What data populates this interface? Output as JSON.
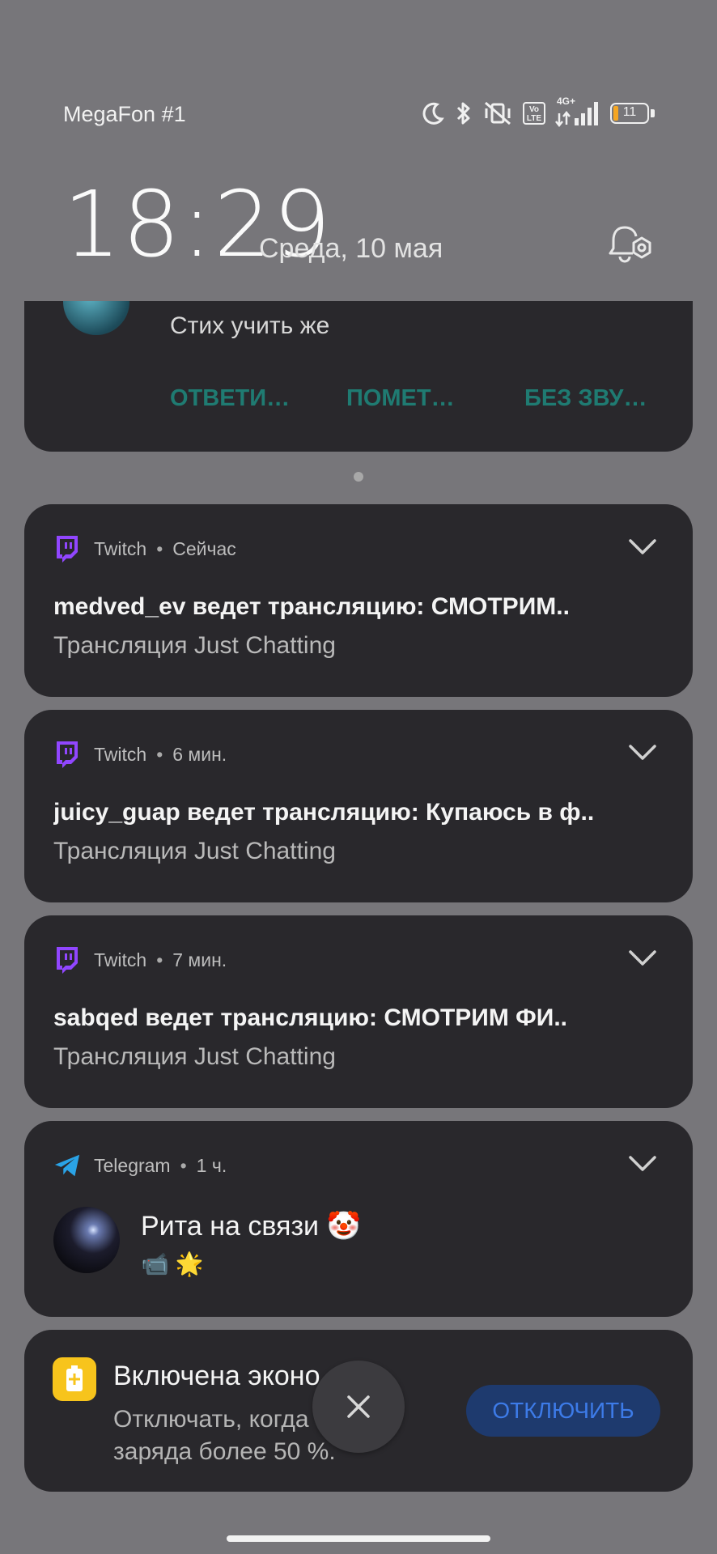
{
  "status_bar": {
    "carrier": "MegaFon #1",
    "network_label": "4G+",
    "volte_label": "Vo LTE",
    "battery_level": "11"
  },
  "lock": {
    "time": "18:29",
    "date": "Среда, 10 мая"
  },
  "top_message": {
    "text": "Стих учить же",
    "actions": [
      "ОТВЕТИ…",
      "ПОМЕТ…",
      "БЕЗ ЗВУ…"
    ]
  },
  "notifications": [
    {
      "app": "Twitch",
      "time": "Сейчас",
      "title": "medved_ev ведет трансляцию: СМОТРИМ..",
      "subtitle": "Трансляция Just Chatting"
    },
    {
      "app": "Twitch",
      "time": "6 мин.",
      "title": "juicy_guap ведет трансляцию: Купаюсь в ф..",
      "subtitle": "Трансляция Just Chatting"
    },
    {
      "app": "Twitch",
      "time": "7 мин.",
      "title": "sabqed ведет трансляцию: СМОТРИМ ФИ..",
      "subtitle": "Трансляция Just Chatting"
    }
  ],
  "telegram": {
    "app": "Telegram",
    "time": "1 ч.",
    "title": "Рита на связи 🤡",
    "body": "📹 🌟"
  },
  "battery_saver": {
    "title": "Включена эконо… э…",
    "line1": "Отключать, когда … ень",
    "line2": "заряда более 50 %.",
    "button": "ОТКЛЮЧИТЬ"
  },
  "colors": {
    "background": "#77767a",
    "card": "#29282c",
    "twitch_purple": "#9146ff",
    "telegram_blue": "#2aa3e6",
    "action_teal": "#1f7b72",
    "battery_button": "#1e3a6e"
  }
}
